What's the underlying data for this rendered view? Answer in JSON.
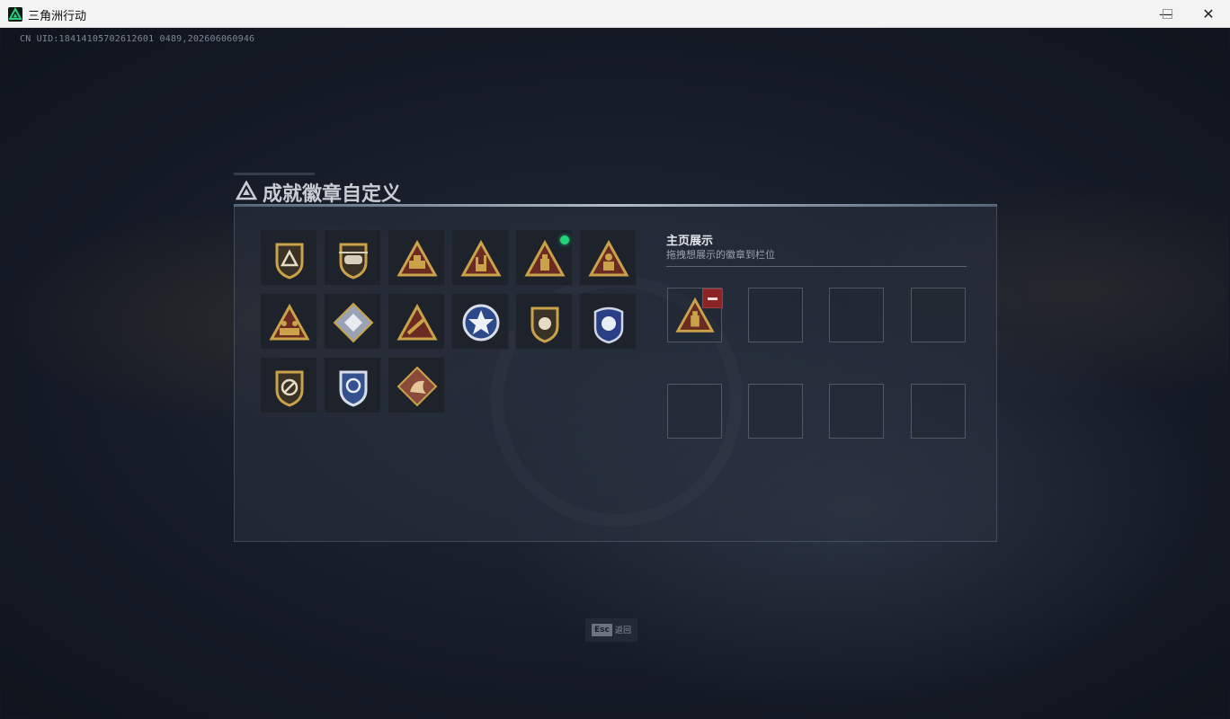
{
  "window": {
    "title": "三角洲行动",
    "controls": {
      "minimize": "—",
      "maximize": "☐",
      "close": "✕"
    }
  },
  "uid_text": "CN UID:18414105702612601 0489,202606060946",
  "panel": {
    "title": "成就徽章自定义"
  },
  "badges": [
    {
      "icon": "shield-triangle-badge-icon",
      "new": false
    },
    {
      "icon": "helicopter-badge-icon",
      "new": false
    },
    {
      "icon": "tank-triangle-badge-icon",
      "new": false
    },
    {
      "icon": "hand-horns-triangle-badge-icon",
      "new": false
    },
    {
      "icon": "bottle-triangle-badge-icon",
      "new": true
    },
    {
      "icon": "figure-triangle-badge-icon",
      "new": false
    },
    {
      "icon": "figure-group-triangle-badge-icon",
      "new": false
    },
    {
      "icon": "diamond-emblem-badge-icon",
      "new": false
    },
    {
      "icon": "rocket-triangle-badge-icon",
      "new": false
    },
    {
      "icon": "star-shield-badge-icon",
      "new": false
    },
    {
      "icon": "mechanism-shield-badge-icon",
      "new": false
    },
    {
      "icon": "police-badge-icon",
      "new": false
    },
    {
      "icon": "no-knife-shield-badge-icon",
      "new": false
    },
    {
      "icon": "blue-wreath-shield-badge-icon",
      "new": false
    },
    {
      "icon": "dragon-diamond-badge-icon",
      "new": false
    }
  ],
  "showcase": {
    "title": "主页展示",
    "subtitle": "拖拽想展示的徽章到栏位",
    "slots": [
      {
        "filled": true,
        "icon": "bottle-triangle-badge-icon"
      },
      {
        "filled": false
      },
      {
        "filled": false
      },
      {
        "filled": false
      },
      {
        "filled": false
      },
      {
        "filled": false
      },
      {
        "filled": false
      },
      {
        "filled": false
      }
    ]
  },
  "footer": {
    "esc_key": "Esc",
    "esc_label": "返回"
  },
  "colors": {
    "gold": "#c9a24a",
    "dark_red": "#6b2b22",
    "accent_green": "#24d37b",
    "remove_red": "#8b2424"
  }
}
